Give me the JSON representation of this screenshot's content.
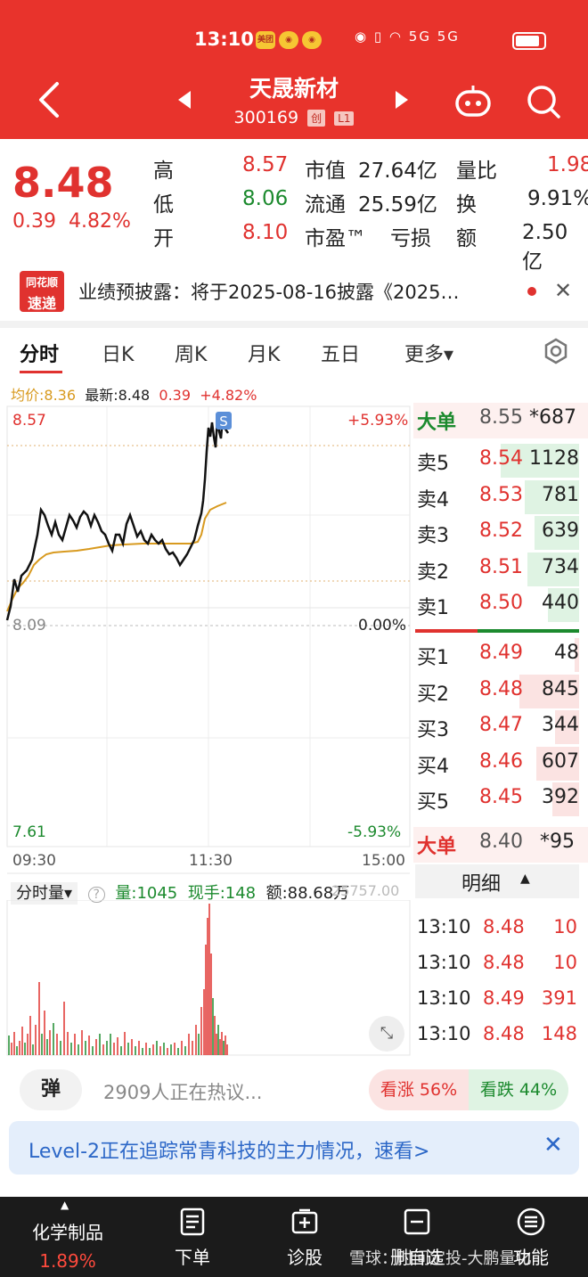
{
  "status": {
    "time": "13:10",
    "badge1": "美团",
    "signal_text": "5G 5G"
  },
  "header": {
    "name": "天晟新材",
    "code": "300169",
    "tag1": "创",
    "tag2": "L1"
  },
  "quote": {
    "price": "8.48",
    "change": "0.39",
    "change_pct": "4.82%",
    "high_label": "高",
    "high": "8.57",
    "low_label": "低",
    "low": "8.06",
    "open_label": "开",
    "open": "8.10",
    "mktcap_label": "市值",
    "mktcap": "27.64亿",
    "float_label": "流通",
    "float": "25.59亿",
    "pe_label": "市盈™",
    "pe": "亏损",
    "volratio_label": "量比",
    "volratio": "1.98",
    "turnover_label": "换",
    "turnover": "9.91%",
    "amount_label": "额",
    "amount": "2.50亿"
  },
  "news": {
    "logo_top": "同花顺",
    "logo_bottom": "速递",
    "text": "业绩预披露：将于2025-08-16披露《2025…"
  },
  "tabs": [
    "分时",
    "日K",
    "周K",
    "月K",
    "五日",
    "更多▾"
  ],
  "chart": {
    "summary_avg": "均价:8.36",
    "summary_last": "最新:8.48",
    "summary_chg": "0.39",
    "summary_pct": "+4.82%",
    "y_top": "8.57",
    "y_mid": "8.09",
    "y_bot": "7.61",
    "pct_top": "+5.93%",
    "pct_mid": "0.00%",
    "pct_bot": "-5.93%",
    "x_start": "09:30",
    "x_mid": "11:30",
    "x_end": "15:00",
    "marker": "S"
  },
  "orderbook": {
    "big_sell": {
      "label": "大单",
      "price": "8.55",
      "vol": "*687"
    },
    "asks": [
      {
        "label": "卖5",
        "price": "8.54",
        "vol": "1128",
        "fill": 0.55
      },
      {
        "label": "卖4",
        "price": "8.53",
        "vol": "781",
        "fill": 0.38
      },
      {
        "label": "卖3",
        "price": "8.52",
        "vol": "639",
        "fill": 0.31
      },
      {
        "label": "卖2",
        "price": "8.51",
        "vol": "734",
        "fill": 0.36
      },
      {
        "label": "卖1",
        "price": "8.50",
        "vol": "440",
        "fill": 0.22
      }
    ],
    "bids": [
      {
        "label": "买1",
        "price": "8.49",
        "vol": "48",
        "fill": 0.03
      },
      {
        "label": "买2",
        "price": "8.48",
        "vol": "845",
        "fill": 0.42
      },
      {
        "label": "买3",
        "price": "8.47",
        "vol": "344",
        "fill": 0.17
      },
      {
        "label": "买4",
        "price": "8.46",
        "vol": "607",
        "fill": 0.3
      },
      {
        "label": "买5",
        "price": "8.45",
        "vol": "392",
        "fill": 0.19
      }
    ],
    "big_buy": {
      "label": "大单",
      "price": "8.40",
      "vol": "*95"
    },
    "detail_label": "明细",
    "ticks": [
      {
        "time": "13:10",
        "price": "8.48",
        "vol": "10"
      },
      {
        "time": "13:10",
        "price": "8.48",
        "vol": "10"
      },
      {
        "time": "13:10",
        "price": "8.49",
        "vol": "391"
      },
      {
        "time": "13:10",
        "price": "8.48",
        "vol": "148"
      }
    ]
  },
  "volume": {
    "selector": "分时量▾",
    "vol_text": "量:1045",
    "now_text": "现手:148",
    "amount_text": "额:88.68万",
    "max_text": "25757.00"
  },
  "comment": {
    "danmu": "弹",
    "text": "2909人正在热议...",
    "bull": "看涨 56%",
    "bear": "看跌 44%"
  },
  "level2": {
    "text": "Level-2正在追踪常青科技的主力情况，速看>"
  },
  "nav": {
    "sector": "化学制品",
    "sector_pct": "1.89%",
    "order": "下单",
    "diagnose": "诊股",
    "watch": "删自选",
    "func": "功能"
  },
  "watermark": "雪球：时间定投-大鹏量化",
  "colors": {
    "up": "#e0322f",
    "down": "#1c8a2e",
    "header": "#e8332c",
    "avg_line": "#d89a1f"
  }
}
